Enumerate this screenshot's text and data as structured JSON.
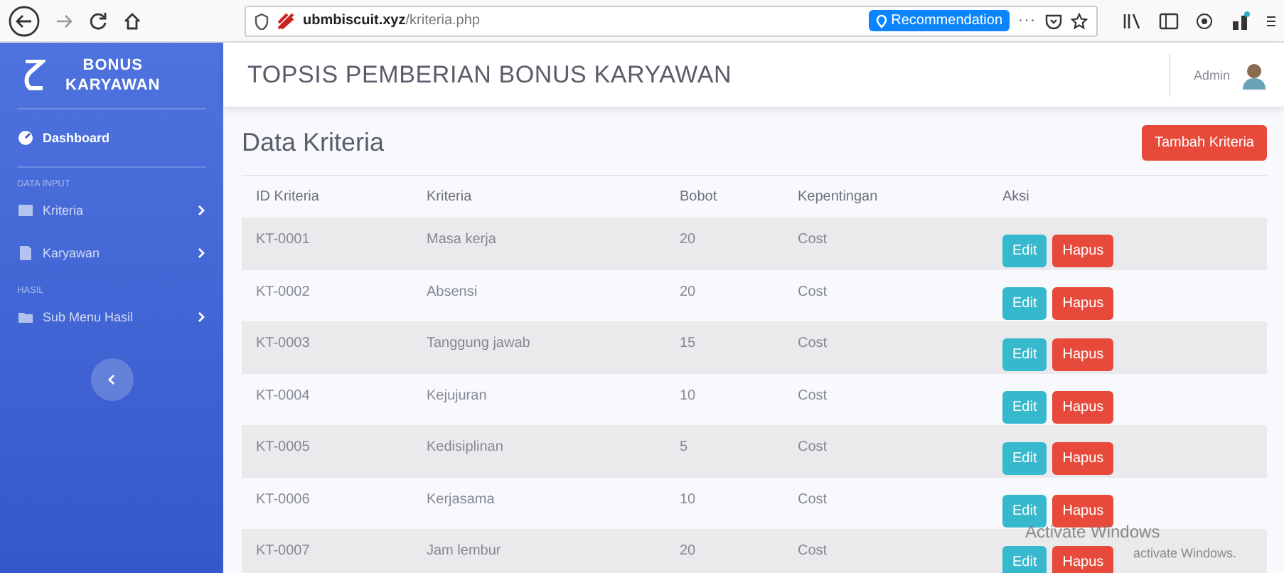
{
  "browser": {
    "url_domain": "ubmbiscuit.xyz",
    "url_path": "/kriteria.php",
    "recommendation": "Recommendation",
    "more": "···"
  },
  "sidebar": {
    "brand": [
      "BONUS",
      "KARYAWAN"
    ],
    "items": [
      {
        "kind": "link",
        "label": "Dashboard",
        "selected": true
      },
      {
        "kind": "heading",
        "label": "DATA INPUT"
      },
      {
        "kind": "submenu",
        "label": "Kriteria",
        "selected": false
      },
      {
        "kind": "submenu",
        "label": "Karyawan",
        "selected": false
      },
      {
        "kind": "heading",
        "label": "HASIL"
      },
      {
        "kind": "submenu",
        "label": "Sub Menu Hasil",
        "selected": false
      }
    ]
  },
  "header": {
    "title": "TOPSIS PEMBERIAN BONUS KARYAWAN",
    "user": "Admin"
  },
  "page": {
    "title": "Data Kriteria",
    "add_button": "Tambah Kriteria"
  },
  "table": {
    "columns": [
      "ID Kriteria",
      "Kriteria",
      "Bobot",
      "Kepentingan",
      "Aksi"
    ],
    "rows": [
      {
        "cells": [
          "KT-0001",
          "Masa kerja",
          "20",
          "Cost"
        ],
        "actions": [
          "Edit",
          "Hapus"
        ]
      },
      {
        "cells": [
          "KT-0002",
          "Absensi",
          "20",
          "Cost"
        ],
        "actions": [
          "Edit",
          "Hapus"
        ]
      },
      {
        "cells": [
          "KT-0003",
          "Tanggung jawab",
          "15",
          "Cost"
        ],
        "actions": [
          "Edit",
          "Hapus"
        ]
      },
      {
        "cells": [
          "KT-0004",
          "Kejujuran",
          "10",
          "Cost"
        ],
        "actions": [
          "Edit",
          "Hapus"
        ]
      },
      {
        "cells": [
          "KT-0005",
          "Kedisiplinan",
          "5",
          "Cost"
        ],
        "actions": [
          "Edit",
          "Hapus"
        ]
      },
      {
        "cells": [
          "KT-0006",
          "Kerjasama",
          "10",
          "Cost"
        ],
        "actions": [
          "Edit",
          "Hapus"
        ]
      },
      {
        "cells": [
          "KT-0007",
          "Jam lembur",
          "20",
          "Cost"
        ],
        "actions": [
          "Edit",
          "Hapus"
        ]
      }
    ]
  },
  "os_notice": {
    "title": "Activate Windows",
    "text": "activate Windows."
  }
}
